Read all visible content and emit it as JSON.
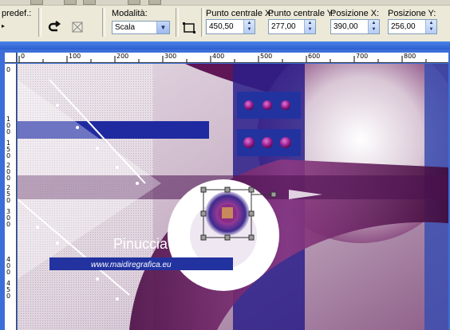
{
  "toolbar": {
    "preset_label": "predef.:",
    "mode_label": "Modalità:",
    "mode_value": "Scala",
    "center_x_label": "Punto centrale X:",
    "center_x_value": "450,50",
    "center_y_label": "Punto centrale Y:",
    "center_y_value": "277,00",
    "pos_x_label": "Posizione X:",
    "pos_x_value": "390,00",
    "pos_y_label": "Posizione Y:",
    "pos_y_value": "256,00"
  },
  "ruler": {
    "h_labels": [
      "0",
      "100",
      "200",
      "300",
      "400",
      "500",
      "600",
      "700",
      "800"
    ],
    "v_labels": [
      "0",
      "100",
      "150",
      "200",
      "250",
      "300",
      "400",
      "450"
    ]
  },
  "canvas": {
    "watermark_name": "Pinuccia",
    "watermark_url": "www.maidiregrafica.eu"
  },
  "colors": {
    "purple": "#6a1a5e",
    "blue": "#2233a0",
    "toolbar_bg": "#ece9d8"
  }
}
